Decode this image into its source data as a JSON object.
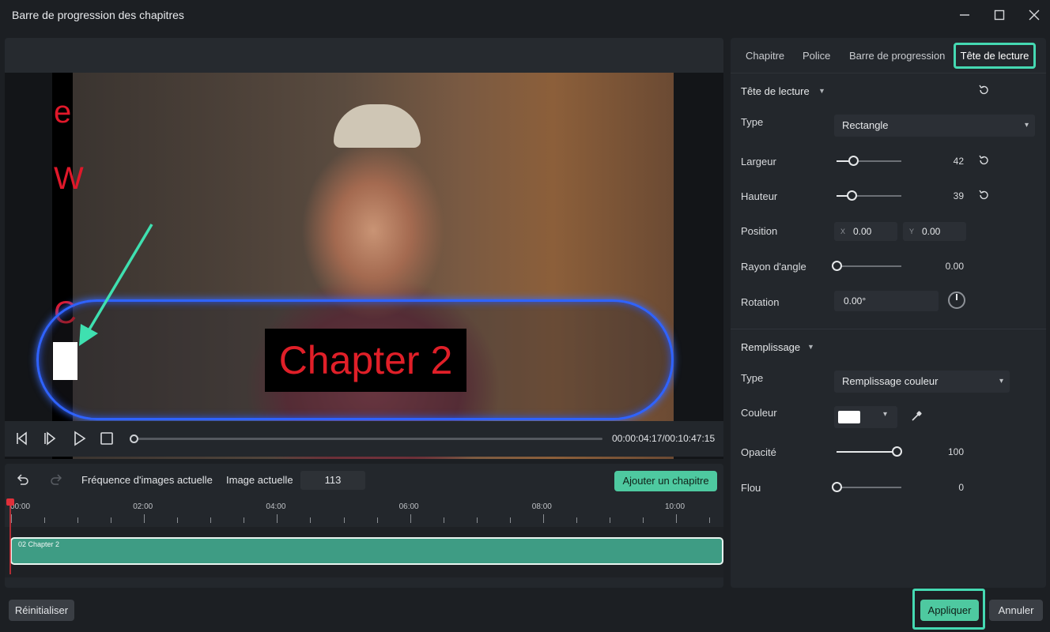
{
  "window": {
    "title": "Barre de progression des chapitres"
  },
  "preview": {
    "overlay_letters": [
      "e",
      "W",
      "C"
    ],
    "chapter_text": "Chapter 2",
    "timecode": "00:00:04:17/00:10:47:15",
    "progress_fraction": 0.0
  },
  "timeline_toolbar": {
    "frame_rate_label": "Fréquence d'images actuelle",
    "current_frame_label": "Image actuelle",
    "current_frame_value": "113",
    "add_chapter_label": "Ajouter un chapitre"
  },
  "ruler": {
    "labels": [
      "00:00",
      "02:00",
      "04:00",
      "06:00",
      "08:00",
      "10:00"
    ]
  },
  "clip": {
    "label": "02 Chapter 2"
  },
  "tabs": {
    "items": [
      "Chapitre",
      "Police",
      "Barre de progression",
      "Tête de lecture"
    ],
    "active": "Tête de lecture"
  },
  "playhead_section": {
    "title": "Tête de lecture",
    "type_label": "Type",
    "type_value": "Rectangle",
    "width_label": "Largeur",
    "width_value": "42",
    "width_fraction": 0.25,
    "height_label": "Hauteur",
    "height_value": "39",
    "height_fraction": 0.23,
    "position_label": "Position",
    "pos_x_axis": "X",
    "pos_x_value": "0.00",
    "pos_y_axis": "Y",
    "pos_y_value": "0.00",
    "radius_label": "Rayon d'angle",
    "radius_value": "0.00",
    "radius_fraction": 0.0,
    "rotation_label": "Rotation",
    "rotation_value": "0.00°"
  },
  "fill_section": {
    "title": "Remplissage",
    "type_label": "Type",
    "type_value": "Remplissage couleur",
    "color_label": "Couleur",
    "color_value": "#ffffff",
    "opacity_label": "Opacité",
    "opacity_value": "100",
    "opacity_fraction": 1.0,
    "blur_label": "Flou",
    "blur_value": "0",
    "blur_fraction": 0.0
  },
  "buttons": {
    "reset": "Réinitialiser",
    "apply": "Appliquer",
    "cancel": "Annuler"
  },
  "colors": {
    "accent": "#4ec9a0",
    "highlight": "#45d9b2",
    "chapter_text": "#e01f28",
    "pill_border": "#2f63ff",
    "clip": "#3e9c84",
    "playhead_marker": "#e0303a"
  },
  "icons": {
    "minimize": "minimize-icon",
    "maximize": "maximize-icon",
    "close": "close-icon",
    "prev_frame": "step-back-icon",
    "next_frame": "step-forward-icon",
    "play": "play-icon",
    "stop": "stop-icon",
    "undo": "undo-icon",
    "redo": "redo-icon",
    "reset": "reset-icon",
    "eyedropper": "eyedropper-icon"
  }
}
